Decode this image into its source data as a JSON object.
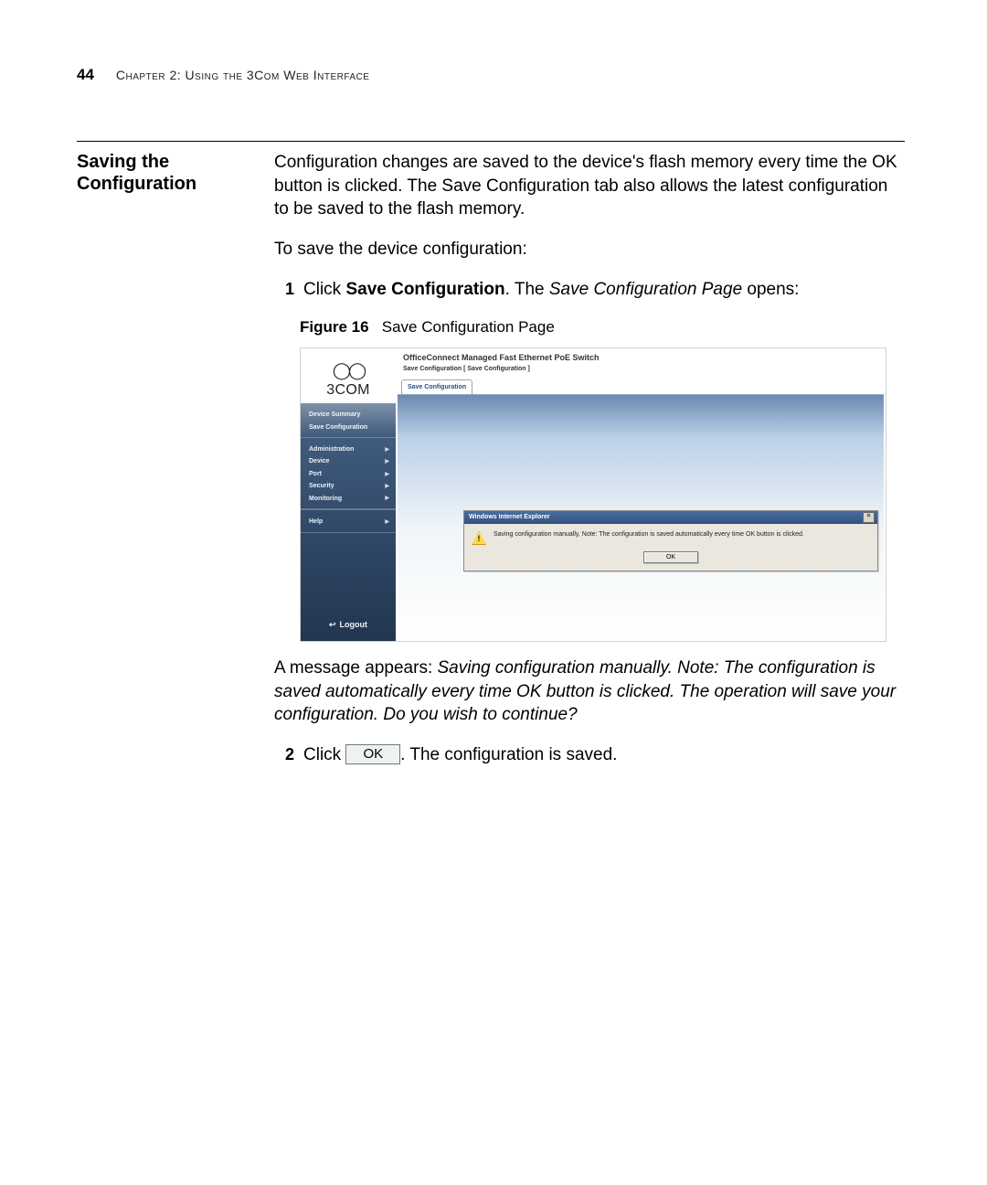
{
  "page": {
    "number": "44",
    "chapter_label": "Chapter 2: Using the 3Com Web Interface"
  },
  "section": {
    "title_line1": "Saving the",
    "title_line2": "Configuration",
    "intro": "Configuration changes are saved to the device's flash memory every time the OK button is clicked. The Save Configuration tab also allows the latest configuration to be saved to the flash memory.",
    "subintro": "To save the device configuration:",
    "step1_before": "Click ",
    "step1_bold": "Save Configuration",
    "step1_after_before_emph": ". The ",
    "step1_emph": "Save Configuration Page",
    "step1_after_emph": " opens:",
    "step2_before": "Click ",
    "step2_button_label": "OK",
    "step2_after": ". The configuration is saved."
  },
  "figure": {
    "label_strong": "Figure 16",
    "label_rest": "Save Configuration Page"
  },
  "screenshot": {
    "brand_glyphs": "◯◯",
    "brand_text": "3COM",
    "sidebar_top": [
      "Device Summary",
      "Save Configuration"
    ],
    "sidebar_main": [
      "Administration",
      "Device",
      "Port",
      "Security",
      "Monitoring"
    ],
    "sidebar_help": "Help",
    "logout_icon": "↩",
    "logout_label": "Logout",
    "header_title": "OfficeConnect Managed Fast Ethernet PoE Switch",
    "breadcrumb": "Save Configuration [ Save Configuration ]",
    "tab_label": "Save Configuration",
    "dialog": {
      "title": "Windows Internet Explorer",
      "close_glyph": "×",
      "message": "Saving configuration manually, Note: The configuration is saved automatically every time OK button is clicked.",
      "ok_label": "OK"
    }
  },
  "afterfig": {
    "lead": "A message appears: ",
    "emph": "Saving configuration manually. Note: The configuration is saved automatically every time OK button is clicked. The operation will save your configuration. Do you wish to continue?"
  }
}
